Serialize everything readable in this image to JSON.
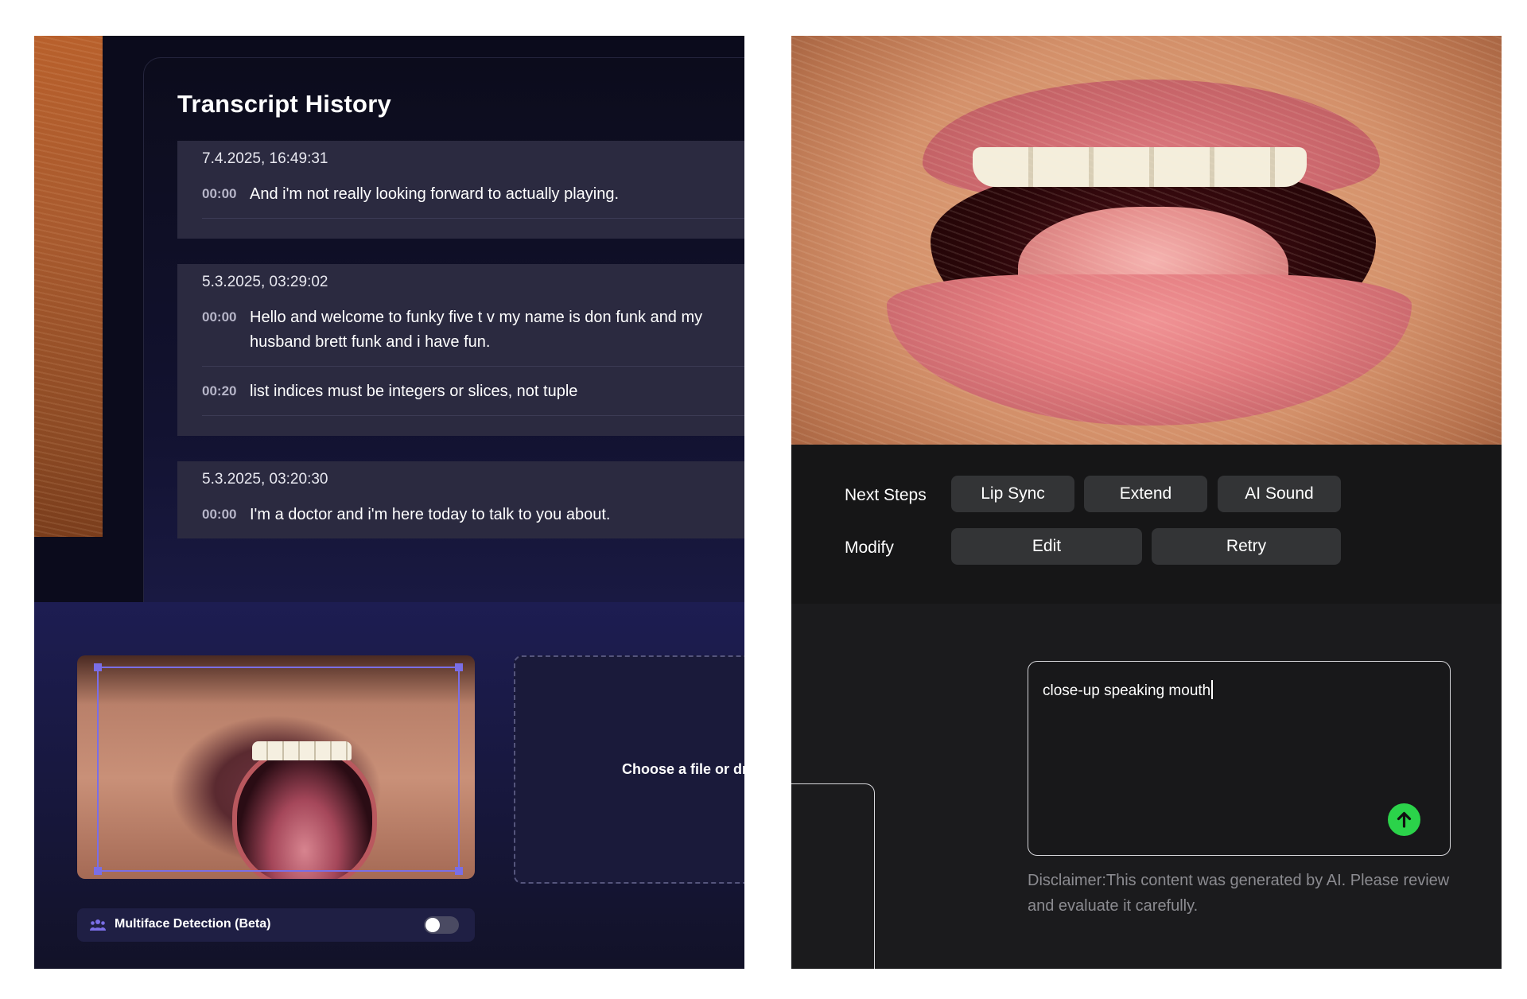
{
  "transcript": {
    "title": "Transcript History",
    "sessions": [
      {
        "date": "7.4.2025, 16:49:31",
        "segments": [
          {
            "time": "00:00",
            "text": "And i'm not really looking forward to actually playing."
          }
        ]
      },
      {
        "date": "5.3.2025, 03:29:02",
        "segments": [
          {
            "time": "00:00",
            "text": "Hello and welcome to funky five t v my name is don funk and my husband brett funk and i have fun."
          },
          {
            "time": "00:20",
            "text": "list indices must be integers or slices, not tuple"
          }
        ]
      },
      {
        "date": "5.3.2025, 03:20:30",
        "segments": [
          {
            "time": "00:00",
            "text": "I'm a doctor and i'm here today to talk to you about."
          }
        ]
      }
    ]
  },
  "upload": {
    "dropzone_label": "Choose a file or dr",
    "multiface_label": "Multiface Detection (Beta)",
    "multiface_enabled": false
  },
  "actions": {
    "next_steps_label": "Next Steps",
    "modify_label": "Modify",
    "lip_sync": "Lip Sync",
    "extend": "Extend",
    "ai_sound": "AI Sound",
    "edit": "Edit",
    "retry": "Retry"
  },
  "prompt": {
    "value": "close-up speaking mouth",
    "disclaimer": "Disclaimer:This content was generated by AI. Please review and evaluate it carefully."
  },
  "colors": {
    "accent_green": "#2bd34a",
    "selection_purple": "#7a6ee6",
    "button_bg": "#333436"
  }
}
